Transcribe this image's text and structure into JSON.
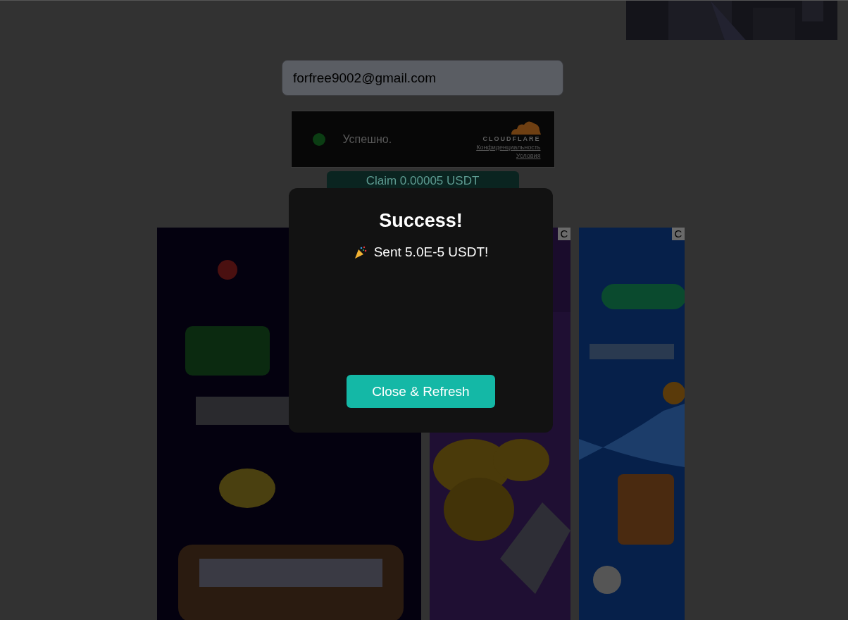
{
  "top_banner": {
    "kind": "picture"
  },
  "email_field": {
    "value": "forfree9002@gmail.com"
  },
  "captcha": {
    "status": "Успешно.",
    "brand": "CLOUDFLARE",
    "links": [
      "Конфиденциальность",
      "Условия"
    ]
  },
  "claim_button": {
    "label": "Claim 0.00005 USDT"
  },
  "ads": [
    {
      "kind": "picture"
    },
    {
      "kind": "picture",
      "close_label": "C"
    },
    {
      "kind": "picture",
      "close_label": "C"
    }
  ],
  "modal": {
    "title": "Success!",
    "message": "Sent 5.0E-5 USDT!",
    "button": "Close & Refresh"
  }
}
